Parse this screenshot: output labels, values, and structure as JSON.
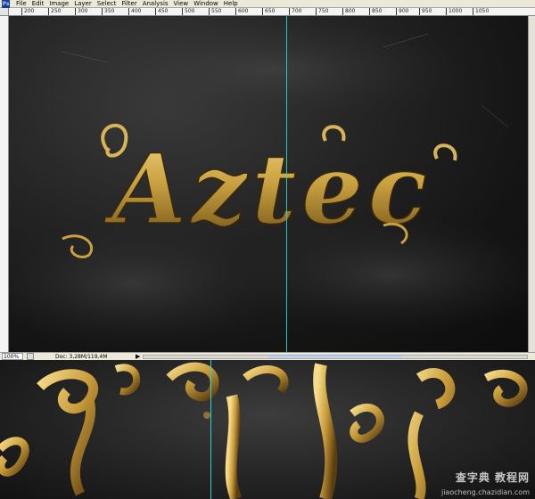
{
  "app": {
    "logo": "Ps"
  },
  "menu": [
    "File",
    "Edit",
    "Image",
    "Layer",
    "Select",
    "Filter",
    "Analysis",
    "View",
    "Window",
    "Help"
  ],
  "ruler": {
    "top_ticks": [
      "200",
      "250",
      "300",
      "350",
      "400",
      "450",
      "500",
      "550",
      "600",
      "650",
      "700",
      "750",
      "800",
      "850",
      "900",
      "950",
      "1000",
      "1050"
    ]
  },
  "artwork": {
    "title": "Aztec"
  },
  "status": {
    "zoom": "100%",
    "doc": "Doc: 3,28M/119,4M",
    "arrow": "▶"
  },
  "watermark": {
    "line1": "查字典 教程网",
    "line2": "jiaocheng.chazidian.com"
  },
  "colors": {
    "gold": "#c8a040",
    "guide": "#29d6d6",
    "background": "#1a1a1a"
  }
}
